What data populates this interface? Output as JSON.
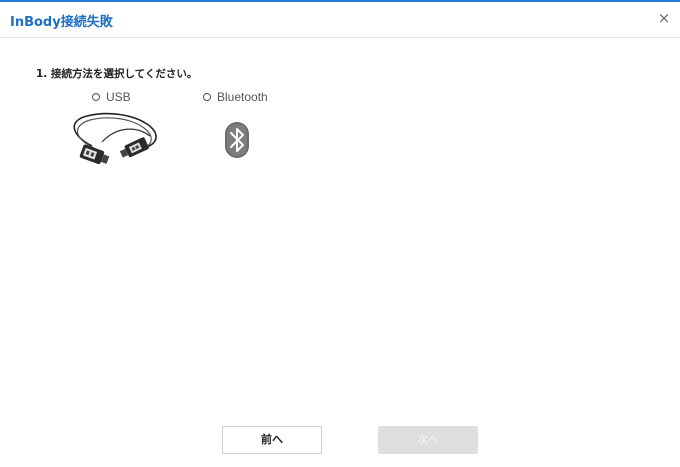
{
  "window": {
    "title": "InBody接続失敗",
    "close_symbol": "×"
  },
  "step": {
    "label": "1. 接続方法を選択してください。"
  },
  "options": [
    {
      "label": "USB",
      "icon": "usb-cable-icon",
      "selected": false
    },
    {
      "label": "Bluetooth",
      "icon": "bluetooth-icon",
      "selected": false
    }
  ],
  "buttons": {
    "prev_label": "前へ",
    "next_label": "次へ",
    "next_enabled": false
  },
  "colors": {
    "accent": "#1f7bd6",
    "title": "#1f6fc2",
    "disabled_button": "#dedede"
  }
}
